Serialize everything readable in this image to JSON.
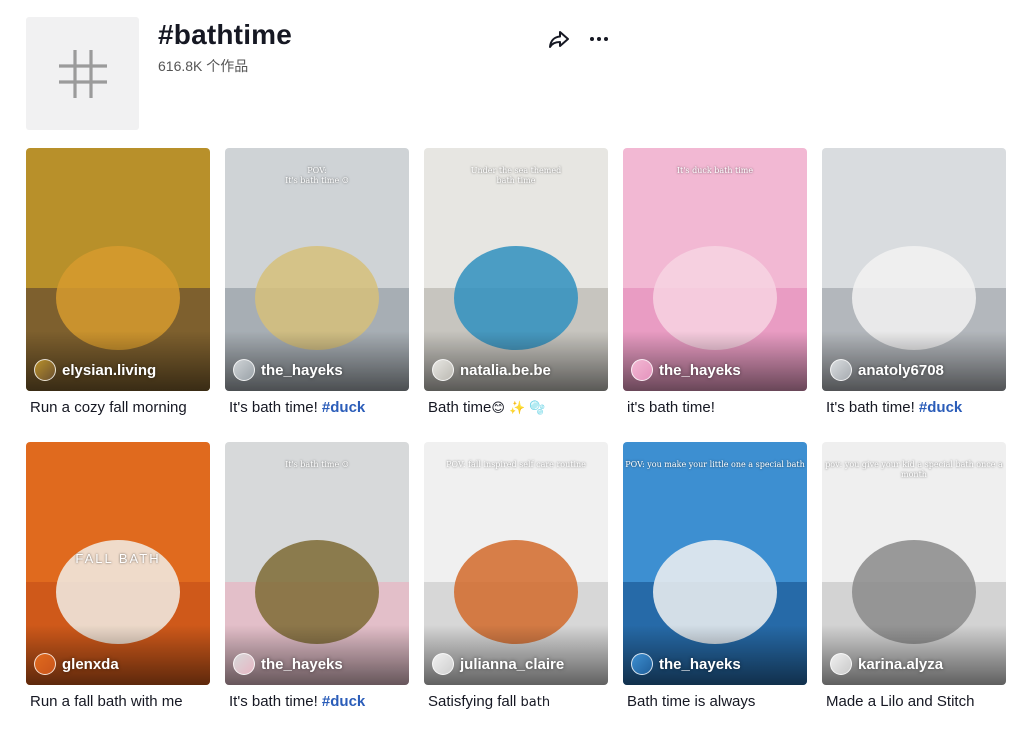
{
  "hashtag": {
    "title": "#bathtime",
    "count": "616.8K 个作品",
    "avatar_icon": "hashtag-icon"
  },
  "actions": {
    "share_icon": "share-icon",
    "more_icon": "more-icon"
  },
  "videos": [
    {
      "author": "elysian.living",
      "caption": "Run a cozy fall morning",
      "hashtag": "",
      "emoji": "",
      "overlay": "",
      "colors": [
        "#b8902a",
        "#6b5030",
        "#d69b2e"
      ]
    },
    {
      "author": "the_hayeks",
      "caption": "It's bath time! ",
      "hashtag": "#duck",
      "emoji": "",
      "overlay": "POV:\nIt's bath time ☺",
      "colors": [
        "#cfd3d6",
        "#9aa2a8",
        "#d6c07a"
      ]
    },
    {
      "author": "natalia.be.be",
      "caption": "Bath time",
      "hashtag": "",
      "emoji": "😊 ✨ 🫧",
      "overlay": "Under the sea themed\nbath time",
      "colors": [
        "#e7e6e2",
        "#bcbab3",
        "#2f8fbe"
      ]
    },
    {
      "author": "the_hayeks",
      "caption": "it's bath time!",
      "hashtag": "",
      "emoji": "",
      "overlay": "It's duck bath time",
      "colors": [
        "#f2b8d3",
        "#e593bd",
        "#f7d3e2"
      ]
    },
    {
      "author": "anatoly6708",
      "caption": "It's bath time! ",
      "hashtag": "#duck",
      "emoji": "",
      "overlay": "",
      "colors": [
        "#d9dcdf",
        "#a6abb0",
        "#f2f2f2"
      ]
    },
    {
      "author": "glenxda",
      "caption": "Run a fall bath with me",
      "hashtag": "",
      "emoji": "",
      "overlay": "FALL BATH",
      "colors": [
        "#e06a1e",
        "#c9541a",
        "#f1efe9"
      ]
    },
    {
      "author": "the_hayeks",
      "caption": "It's bath time! ",
      "hashtag": "#duck",
      "emoji": "",
      "overlay": "It's bath time ☺",
      "colors": [
        "#d7d9da",
        "#e7b6c3",
        "#7e6a34"
      ]
    },
    {
      "author": "julianna_claire",
      "caption": "Satisfying fall",
      "hashtag": "",
      "emoji": " bath",
      "overlay": "POV: fall inspired self care routine",
      "colors": [
        "#f0f0f0",
        "#cfcfcf",
        "#d26a2a"
      ]
    },
    {
      "author": "the_hayeks",
      "caption": "Bath time is always",
      "hashtag": "",
      "emoji": "",
      "overlay": "POV: you make your little one a special bath",
      "colors": [
        "#3d8fd1",
        "#1f5e9a",
        "#f2f2f2"
      ]
    },
    {
      "author": "karina.alyza",
      "caption": "Made a Lilo and Stitch",
      "hashtag": "",
      "emoji": "",
      "overlay": "pov: you give your kid a special bath once a month",
      "colors": [
        "#efefef",
        "#c9c9c9",
        "#8a8a8a"
      ]
    }
  ]
}
